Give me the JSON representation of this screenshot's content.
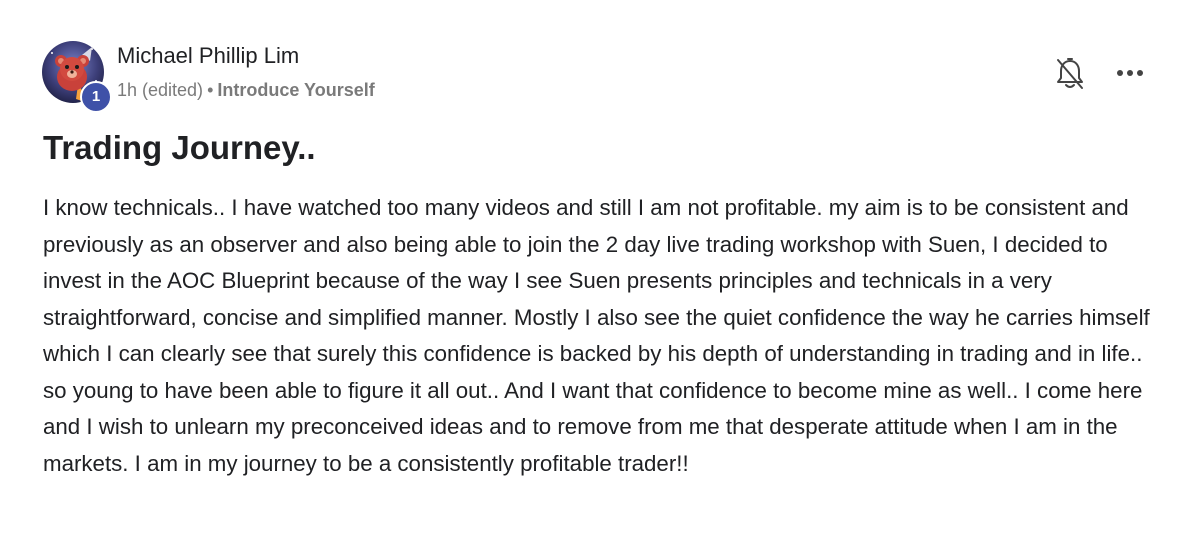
{
  "author": {
    "name": "Michael Phillip Lim",
    "level": "1",
    "avatar_icon": "teddy-bear-rocket-avatar"
  },
  "meta": {
    "time": "1h (edited)",
    "separator": "•",
    "category": "Introduce Yourself"
  },
  "actions": {
    "bell_icon": "bell-off-icon",
    "more_icon": "more-horizontal-icon"
  },
  "post": {
    "title": "Trading Journey..",
    "body": "I know technicals.. I have watched too many videos and still I am not profitable. my aim is to be consistent and previously as an observer and also being able to join the 2 day live trading workshop with Suen, I decided to invest in the AOC Blueprint because of the way I see Suen presents principles and technicals in a very straightforward, concise and simplified manner. Mostly I also see the quiet confidence the way he carries himself which I can clearly see that surely this confidence is backed by his depth of understanding in trading and in life.. so young to have been able to figure it all out.. And I want that confidence to become mine as well.. I come here and I wish to unlearn my preconceived ideas and to remove from me that desperate attitude when I am in the markets. I am in my journey to be a consistently profitable trader!!"
  },
  "colors": {
    "badge": "#3f51a8",
    "text": "#202124",
    "muted": "#7a7a7a"
  }
}
